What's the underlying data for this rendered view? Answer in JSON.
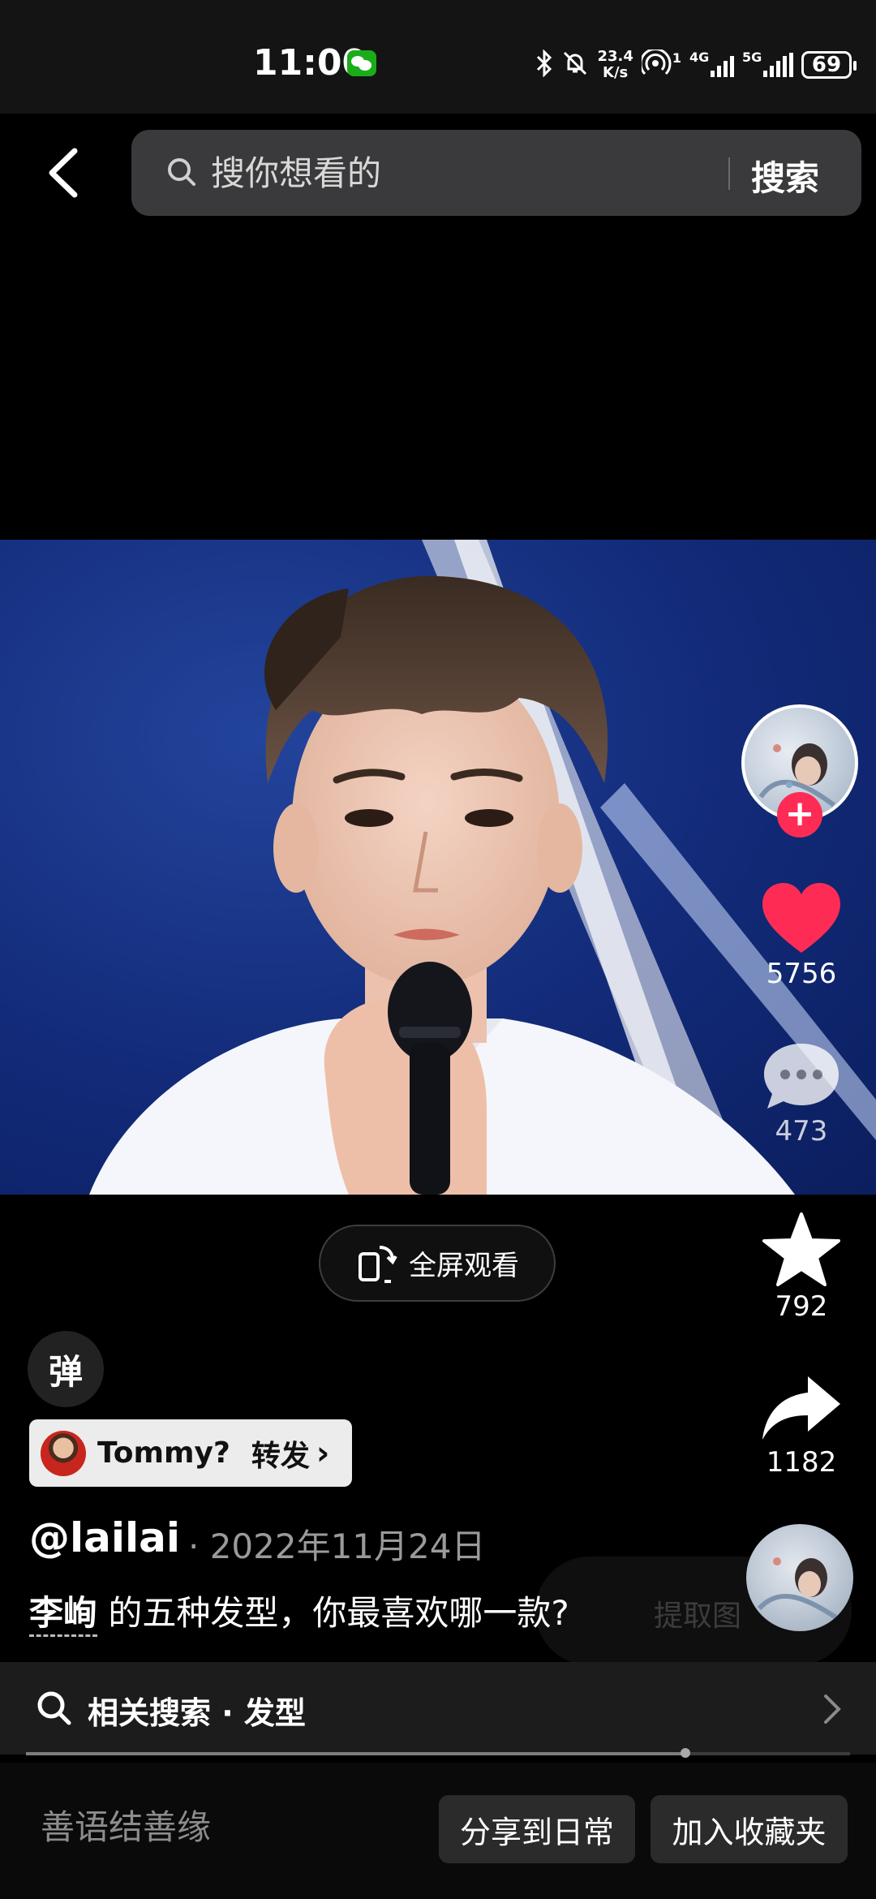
{
  "status_bar": {
    "time": "11:00",
    "net_speed_value": "23.4",
    "net_speed_unit": "K/s",
    "hotspot_count": "1",
    "network_4g": "4G",
    "network_5g": "5G",
    "battery": "69",
    "icons": [
      "wechat-icon",
      "bluetooth-icon",
      "mute-bell-icon",
      "hotspot-icon",
      "signal-icon",
      "battery-icon"
    ]
  },
  "header": {
    "search_placeholder": "搜你想看的",
    "search_button": "搜索"
  },
  "video": {
    "fullscreen_label": "全屏观看",
    "danmaku_label": "弹"
  },
  "actions": {
    "likes": "5756",
    "comments": "473",
    "favorites": "792",
    "shares": "1182",
    "like_color": "#fe2c55"
  },
  "repost": {
    "user": "Tommy?",
    "action": "转发",
    "chevron": "›"
  },
  "post": {
    "author": "@lailai",
    "date": "· 2022年11月24日",
    "mention": "李峋",
    "caption": " 的五种发型，你最喜欢哪一款?",
    "extract_label": "提取图"
  },
  "related_search": {
    "label": "相关搜索 · 发型"
  },
  "playback": {
    "progress": 0.8
  },
  "bottom": {
    "hint": "善语结善缘",
    "share_daily": "分享到日常",
    "add_favorites": "加入收藏夹"
  }
}
